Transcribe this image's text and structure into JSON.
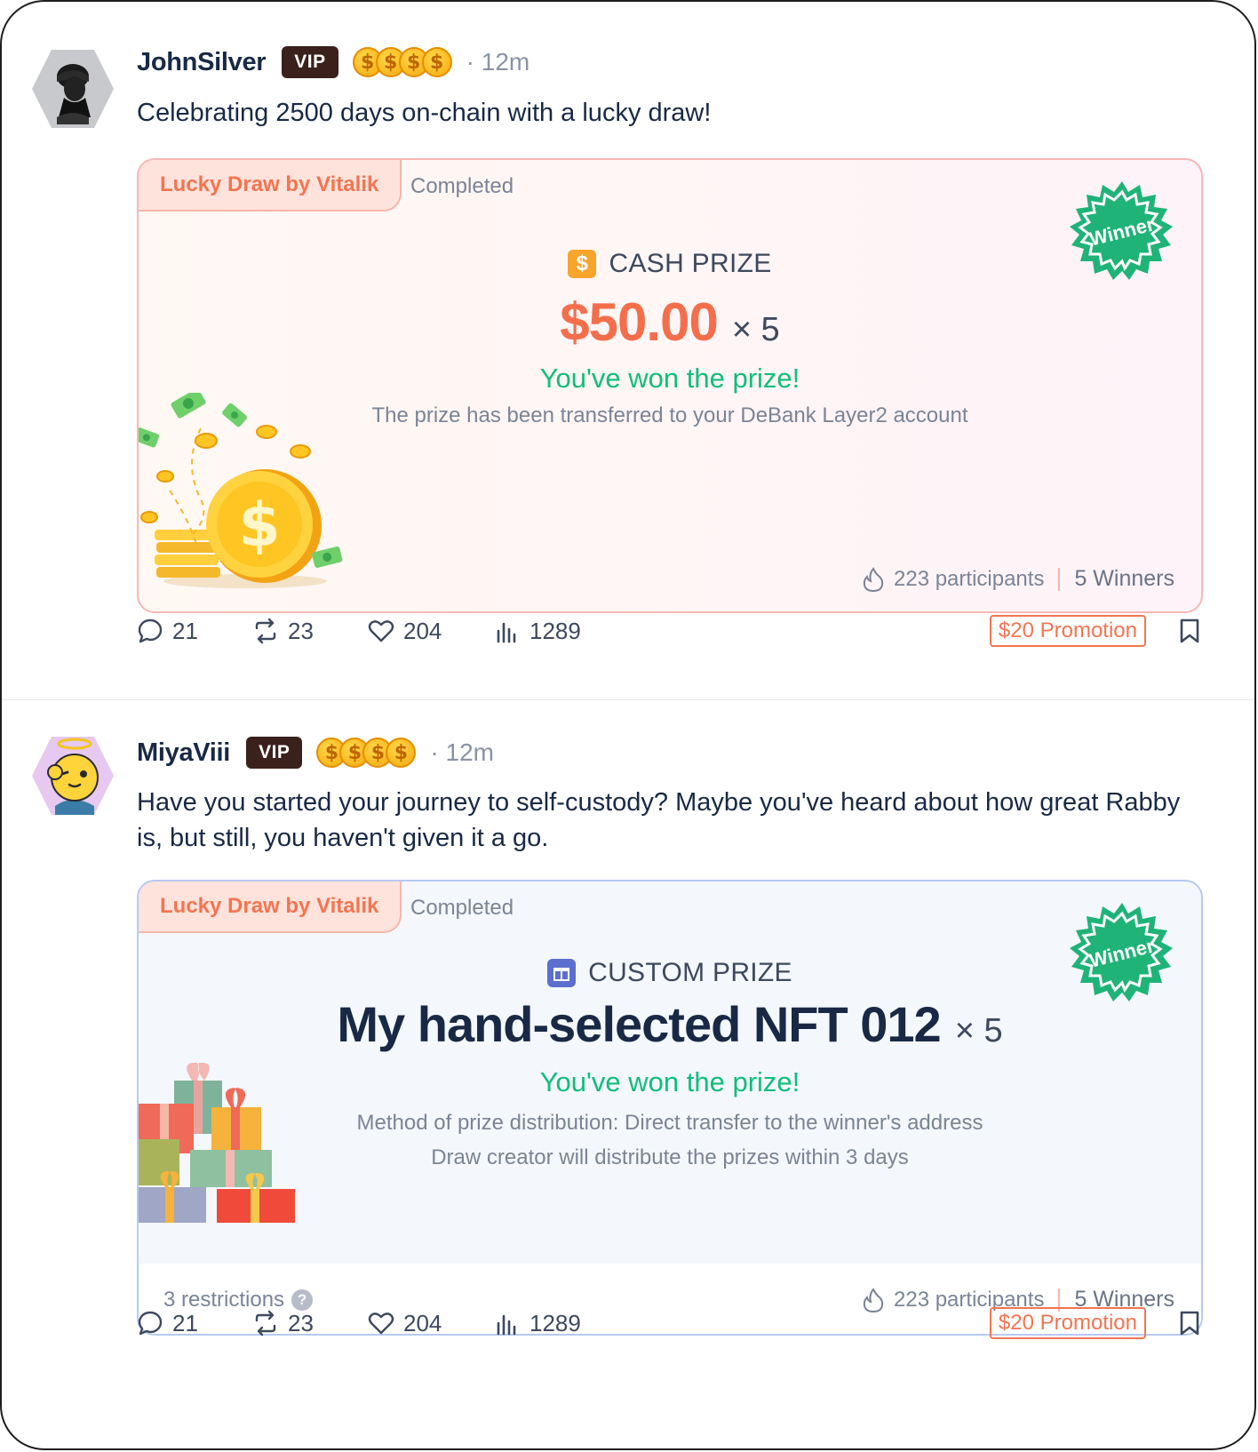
{
  "posts": [
    {
      "author": "JohnSilver",
      "vip_label": "VIP",
      "coin_glyph": "$",
      "time": "· 12m",
      "text": "Celebrating 2500 days on-chain with a lucky draw!",
      "card": {
        "tag": "Lucky Draw by Vitalik",
        "status": "Completed",
        "winner_badge": "Winner",
        "prize_icon": "$",
        "prize_label": "CASH PRIZE",
        "amount": "$50.00",
        "multiplier": "× 5",
        "won_text": "You've won the prize!",
        "desc_lines": [
          "The prize has been transferred to your DeBank Layer2 account"
        ],
        "participants": "223 participants",
        "winners": "5 Winners"
      },
      "actions": {
        "comments": "21",
        "reposts": "23",
        "likes": "204",
        "views": "1289",
        "promotion": "$20 Promotion"
      }
    },
    {
      "author": "MiyaViii",
      "vip_label": "VIP",
      "coin_glyph": "$",
      "time": "· 12m",
      "text": "Have you started your journey to self-custody? Maybe you've heard about how great Rabby is, but still, you haven't given it a go.",
      "card": {
        "tag": "Lucky Draw by Vitalik",
        "status": "Completed",
        "winner_badge": "Winner",
        "prize_label": "CUSTOM PRIZE",
        "amount": "My hand-selected NFT 012",
        "multiplier": "× 5",
        "won_text": "You've won the prize!",
        "desc_lines": [
          "Method of prize distribution: Direct transfer to the winner's address",
          "Draw creator will distribute the prizes within 3 days"
        ],
        "restrictions": "3 restrictions",
        "restrictions_help": "?",
        "participants": "223 participants",
        "winners": "5 Winners"
      },
      "actions": {
        "comments": "21",
        "reposts": "23",
        "likes": "204",
        "views": "1289",
        "promotion": "$20 Promotion"
      }
    }
  ],
  "colors": {
    "accent": "#f27552",
    "won": "#10be7a",
    "badge": "#1fb378",
    "vip": "#3a211c"
  }
}
